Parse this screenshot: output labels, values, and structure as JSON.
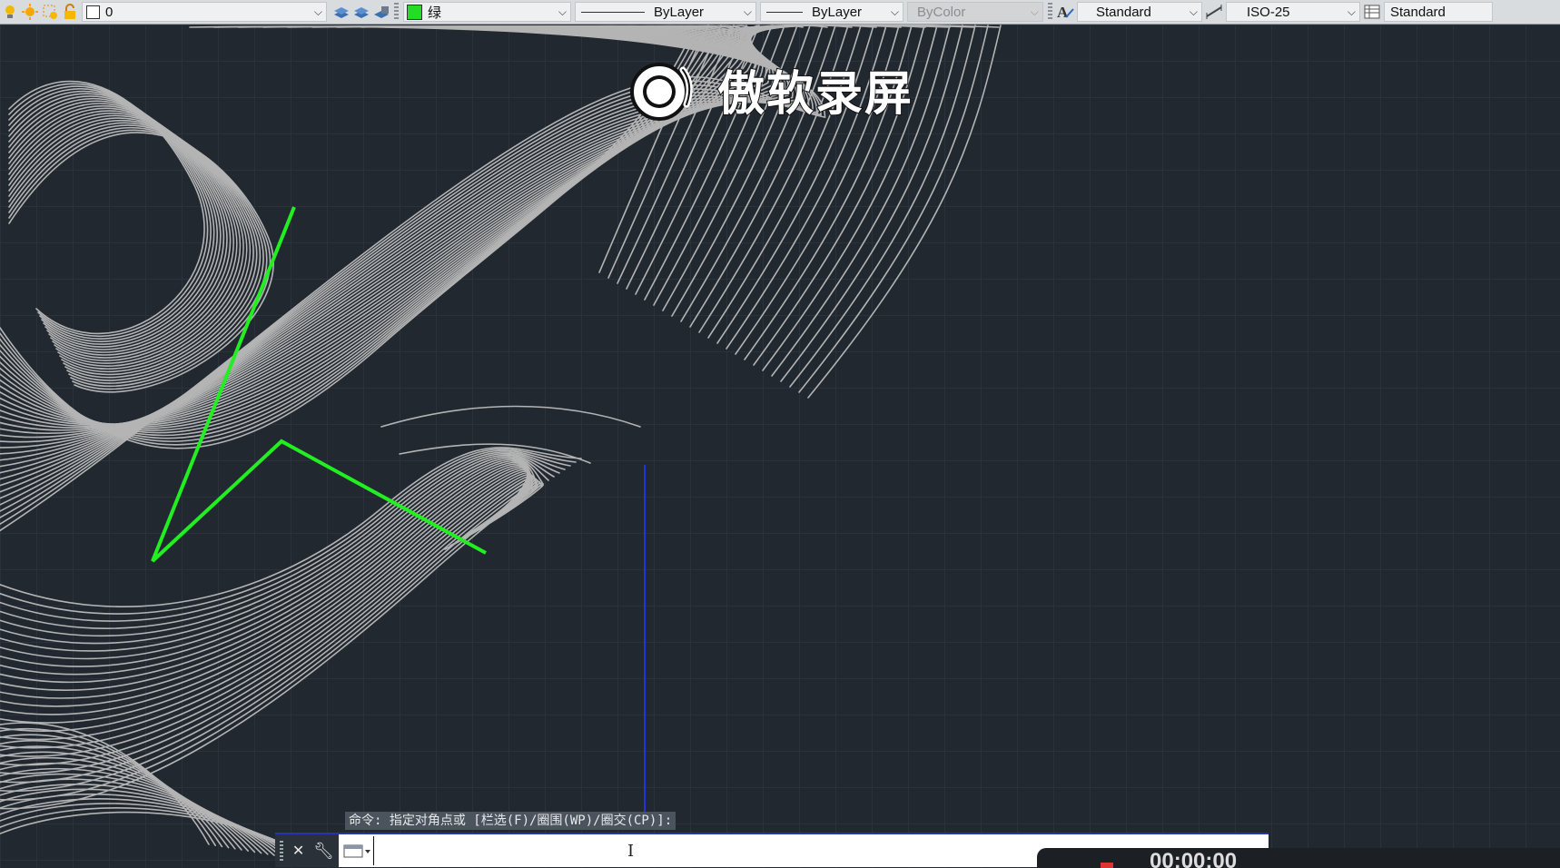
{
  "toolbar": {
    "layer_name": "0",
    "color_label": "绿",
    "color_swatch": "#22dd22",
    "linetype": "ByLayer",
    "lineweight": "ByLayer",
    "plotstyle": "ByColor",
    "text_style": "Standard",
    "dim_style": "ISO-25",
    "table_style": "Standard"
  },
  "watermark": {
    "text": "傲软录屏"
  },
  "command": {
    "prompt": "命令: 指定对角点或 [栏选(F)/圈围(WP)/圈交(CP)]:",
    "input_value": ""
  },
  "status": {
    "time": "00:00:00"
  },
  "colors": {
    "background": "#212830",
    "contour": "#b8b8b8",
    "polyline": "#22ee22",
    "crosshair": "#2633d6"
  },
  "icons": [
    "layer-bulb-icon",
    "sun-icon",
    "freeze-icon",
    "lock-icon",
    "layer-tools-icon",
    "text-style-icon",
    "dim-style-icon",
    "table-style-icon",
    "close-icon",
    "wrench-icon",
    "cursor-icon"
  ]
}
